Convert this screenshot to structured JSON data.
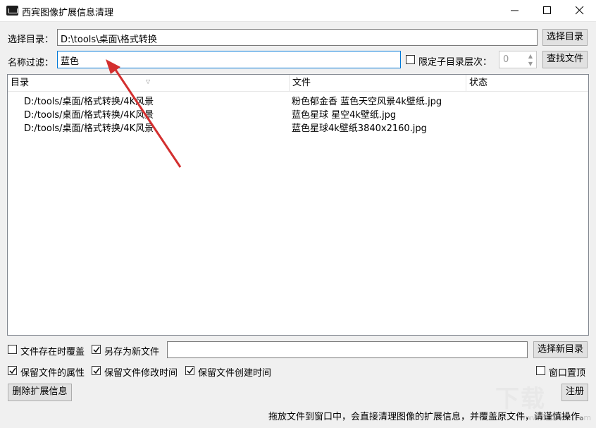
{
  "window": {
    "title": "西宾图像扩展信息清理",
    "icon": "app-icon",
    "controls": [
      "minimize-icon",
      "maximize-icon",
      "close-icon"
    ]
  },
  "directory": {
    "label": "选择目录：",
    "value": "D:\\tools\\桌面\\格式转换",
    "button": "选择目录"
  },
  "filter": {
    "label": "名称过滤：",
    "value": "蓝色",
    "limit_label": "限定子目录层次：",
    "limit_checked": false,
    "depth_value": "0",
    "button": "查找文件"
  },
  "table": {
    "columns": [
      "目录",
      "文件",
      "状态"
    ],
    "rows": [
      {
        "dir": "D:/tools/桌面/格式转换/4K风景",
        "file": "粉色郁金香 蓝色天空风景4k壁纸.jpg",
        "status": ""
      },
      {
        "dir": "D:/tools/桌面/格式转换/4K风景",
        "file": "蓝色星球 星空4k壁纸.jpg",
        "status": ""
      },
      {
        "dir": "D:/tools/桌面/格式转换/4K风景",
        "file": "蓝色星球4k壁纸3840x2160.jpg",
        "status": ""
      }
    ]
  },
  "options": {
    "overwrite_label": "文件存在时覆盖",
    "overwrite_checked": false,
    "save_new_label": "另存为新文件",
    "save_new_checked": true,
    "new_dir_value": "",
    "new_dir_button": "选择新目录",
    "keep_attrs_label": "保留文件的属性",
    "keep_attrs_checked": true,
    "keep_mtime_label": "保留文件修改时间",
    "keep_mtime_checked": true,
    "keep_ctime_label": "保留文件创建时间",
    "keep_ctime_checked": true,
    "topmost_label": "窗口置顶",
    "topmost_checked": false
  },
  "actions": {
    "delete_button": "删除扩展信息",
    "register_button": "注册"
  },
  "status_note": "拖放文件到窗口中，会直接清理图像的扩展信息，并覆盖原文件，请谨慎操作。",
  "watermark": {
    "main": "下载",
    "sub": "www.xiazaiba.com"
  },
  "colors": {
    "accent": "#0078d7",
    "annotation": "#d32f2f"
  }
}
